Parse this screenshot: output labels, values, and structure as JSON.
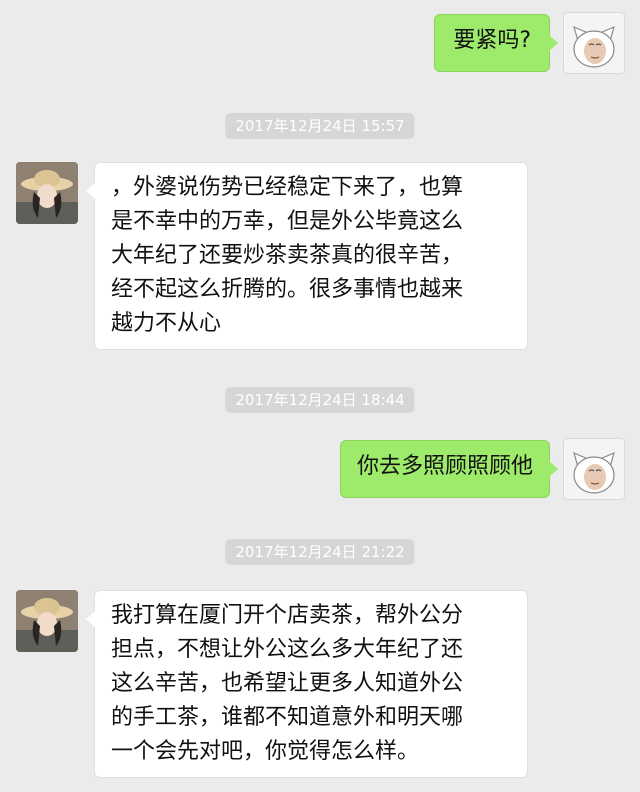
{
  "messages": [
    {
      "sender": "me",
      "text": "要紧吗?"
    },
    {
      "sender": "her",
      "text": "，外婆说伤势已经稳定下来了，也算\n是不幸中的万幸，但是外公毕竟这么\n大年纪了还要炒茶卖茶真的很辛苦，\n经不起这么折腾的。很多事情也越来\n越力不从心"
    },
    {
      "sender": "me",
      "text": "你去多照顾照顾他"
    },
    {
      "sender": "her",
      "text": "我打算在厦门开个店卖茶，帮外公分\n担点，不想让外公这么多大年纪了还\n这么辛苦，也希望让更多人知道外公\n的手工茶，谁都不知道意外和明天哪\n一个会先对吧，你觉得怎么样。"
    }
  ],
  "timestamps": [
    "2017年12月24日 15:57",
    "2017年12月24日 18:44",
    "2017年12月24日 21:22"
  ],
  "colors": {
    "background": "#ebebeb",
    "my_bubble": "#9eea6a",
    "her_bubble": "#ffffff",
    "timestamp_bg": "#d6d6d6"
  },
  "icons": {
    "my_avatar": "cat-face-avatar",
    "her_avatar": "girl-with-hat-avatar"
  }
}
